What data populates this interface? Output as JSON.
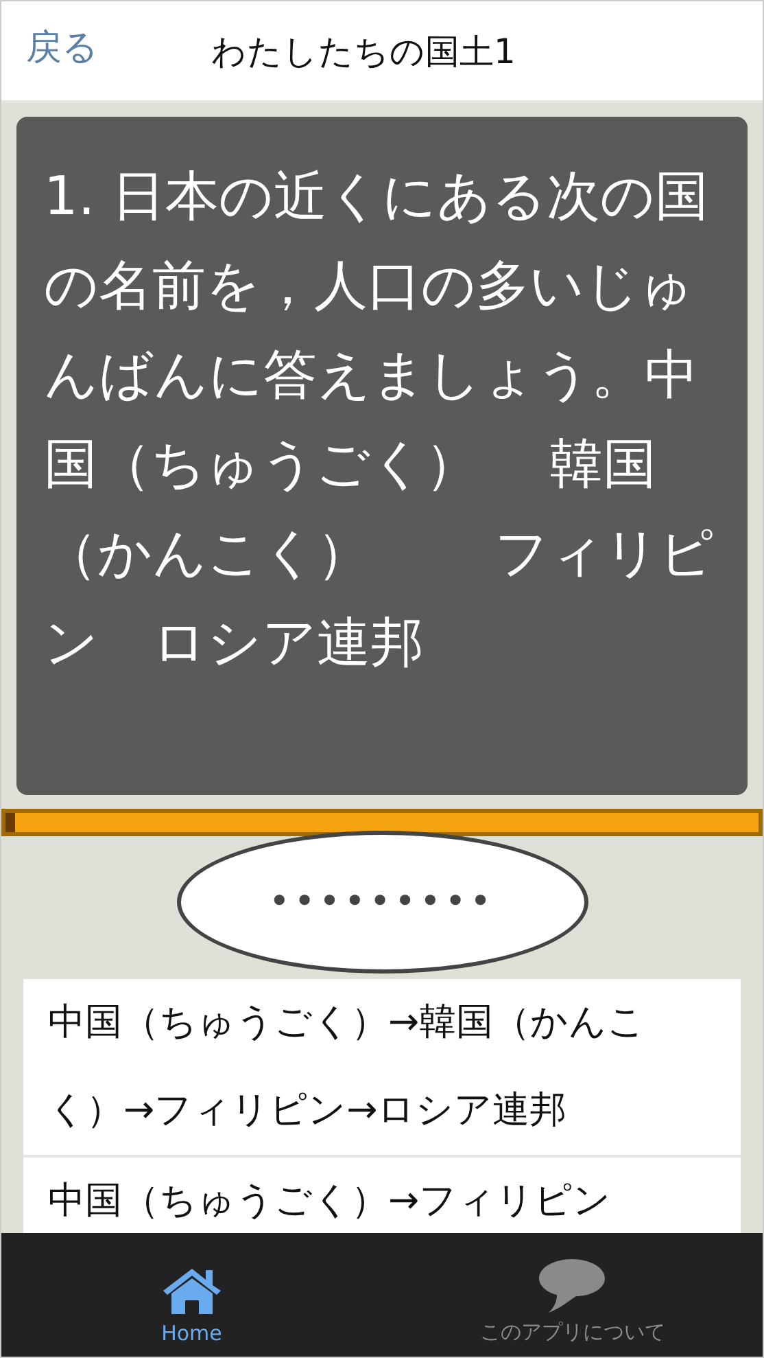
{
  "header": {
    "back": "戻る",
    "title": "わたしたちの国土1"
  },
  "question": "1. 日本の近くにある次の国の名前を，人口の多いじゅんばんに答えましょう。中国（ちゅうごく）　 韓国（かんこく）　　 フィリピン　ロシア連邦",
  "timer": {
    "level": 0.012
  },
  "bubble": "•••••••••",
  "answers": [
    "中国（ちゅうごく）→韓国（かんこく）→フィリピン→ロシア連邦",
    "中国（ちゅうごく）→フィリピン"
  ],
  "tabs": [
    {
      "label": "Home",
      "selected": true
    },
    {
      "label": "このアプリについて",
      "selected": false
    }
  ]
}
